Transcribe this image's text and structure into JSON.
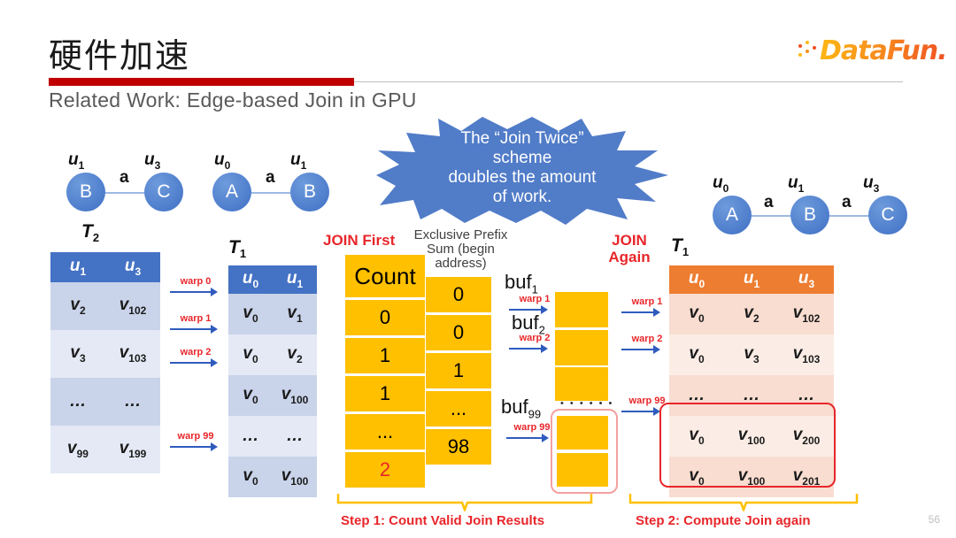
{
  "header": {
    "title": "硬件加速",
    "subtitle": "Related Work: Edge-based Join in GPU",
    "logo_text": "DataFun.",
    "accent_red": "#c00000",
    "logo_orange": "#F78E1E"
  },
  "callout": {
    "line1": "The “Join Twice”",
    "line2": "scheme",
    "line3": "doubles the amount",
    "line4": "of work.",
    "color": "#3F6FC4"
  },
  "graphs": {
    "left": {
      "name": "T2",
      "nodes": [
        {
          "label": "B",
          "var": "u",
          "sub": "1"
        },
        {
          "label": "C",
          "var": "u",
          "sub": "3"
        }
      ],
      "edges": [
        "a"
      ]
    },
    "middle": {
      "name": "T1",
      "nodes": [
        {
          "label": "A",
          "var": "u",
          "sub": "0"
        },
        {
          "label": "B",
          "var": "u",
          "sub": "1"
        }
      ],
      "edges": [
        "a"
      ]
    },
    "right": {
      "nodes": [
        {
          "label": "A",
          "var": "u",
          "sub": "0"
        },
        {
          "label": "B",
          "var": "u",
          "sub": "1"
        },
        {
          "label": "C",
          "var": "u",
          "sub": "3"
        }
      ],
      "edges": [
        "a",
        "a"
      ]
    }
  },
  "table_t2": {
    "name": "T",
    "name_sub": "2",
    "headers": [
      {
        "v": "u",
        "s": "1"
      },
      {
        "v": "u",
        "s": "3"
      }
    ],
    "rows": [
      [
        {
          "v": "v",
          "s": "2"
        },
        {
          "v": "v",
          "s": "102"
        }
      ],
      [
        {
          "v": "v",
          "s": "3"
        },
        {
          "v": "v",
          "s": "103"
        }
      ],
      [
        {
          "v": "…",
          "s": ""
        },
        {
          "v": "…",
          "s": ""
        }
      ],
      [
        {
          "v": "v",
          "s": "99"
        },
        {
          "v": "v",
          "s": "199"
        }
      ]
    ]
  },
  "table_t1_left": {
    "name": "T",
    "name_sub": "1",
    "headers": [
      {
        "v": "u",
        "s": "0"
      },
      {
        "v": "u",
        "s": "1"
      }
    ],
    "rows": [
      [
        {
          "v": "v",
          "s": "0"
        },
        {
          "v": "v",
          "s": "1"
        }
      ],
      [
        {
          "v": "v",
          "s": "0"
        },
        {
          "v": "v",
          "s": "2"
        }
      ],
      [
        {
          "v": "v",
          "s": "0"
        },
        {
          "v": "v",
          "s": "100"
        }
      ],
      [
        {
          "v": "…",
          "s": ""
        },
        {
          "v": "…",
          "s": ""
        }
      ],
      [
        {
          "v": "v",
          "s": "0"
        },
        {
          "v": "v",
          "s": "100"
        }
      ]
    ]
  },
  "table_t1_right": {
    "name": "T",
    "name_sub": "1",
    "headers": [
      {
        "v": "u",
        "s": "0"
      },
      {
        "v": "u",
        "s": "1"
      },
      {
        "v": "u",
        "s": "3"
      }
    ],
    "rows": [
      [
        {
          "v": "v",
          "s": "0"
        },
        {
          "v": "v",
          "s": "2"
        },
        {
          "v": "v",
          "s": "102"
        }
      ],
      [
        {
          "v": "v",
          "s": "0"
        },
        {
          "v": "v",
          "s": "3"
        },
        {
          "v": "v",
          "s": "103"
        }
      ],
      [
        {
          "v": "…",
          "s": ""
        },
        {
          "v": "…",
          "s": ""
        },
        {
          "v": "…",
          "s": ""
        }
      ],
      [
        {
          "v": "v",
          "s": "0"
        },
        {
          "v": "v",
          "s": "100"
        },
        {
          "v": "v",
          "s": "200"
        }
      ],
      [
        {
          "v": "v",
          "s": "0"
        },
        {
          "v": "v",
          "s": "100"
        },
        {
          "v": "v",
          "s": "201"
        }
      ]
    ]
  },
  "count_column": {
    "header": "Count",
    "values": [
      "0",
      "1",
      "1",
      "...",
      "2"
    ],
    "highlight_last": true,
    "highlight_color": "#E8262A"
  },
  "prefix_sum": {
    "caption_line1": "Exclusive Prefix",
    "caption_line2": "Sum (begin",
    "caption_line3": "address)",
    "values": [
      "0",
      "0",
      "1",
      "...",
      "98"
    ]
  },
  "labels": {
    "join_first": "JOIN First",
    "join_again_l1": "JOIN",
    "join_again_l2": "Again",
    "buf1": "buf",
    "buf1_sub": "1",
    "buf2": "buf",
    "buf2_sub": "2",
    "buf99": "buf",
    "buf99_sub": "99",
    "step1": "Step 1: Count Valid Join Results",
    "step2": "Step 2: Compute Join again",
    "ellipsis_dots": "• • • • • •"
  },
  "warps_left": [
    "warp 0",
    "warp 1",
    "warp 2",
    "warp 99"
  ],
  "warps_buf": [
    "warp 1",
    "warp 2",
    "warp 99"
  ],
  "warps_right": [
    "warp 1",
    "warp 2",
    "warp 99"
  ],
  "page_number": "56"
}
